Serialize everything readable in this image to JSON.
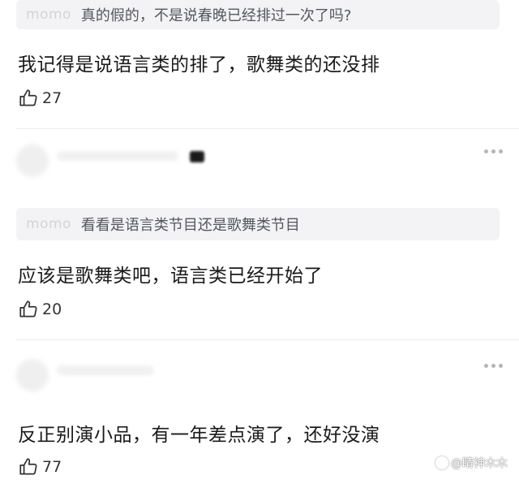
{
  "comments": [
    {
      "quote_name": "momo",
      "quote_text": "真的假的，不是说春晚已经排过一次了吗?",
      "body": "我记得是说语言类的排了，歌舞类的还没排",
      "likes": "27"
    },
    {
      "quote_name": "momo",
      "quote_text": "看看是语言类节目还是歌舞类节目",
      "body": "应该是歌舞类吧，语言类已经开始了",
      "likes": "20"
    },
    {
      "body": "反正别演小品，有一年差点演了，还好没演",
      "likes": "77"
    }
  ],
  "watermark": "@睛神木木",
  "icons": {
    "like": "thumbs-up-icon",
    "more": "more-dots-icon"
  }
}
